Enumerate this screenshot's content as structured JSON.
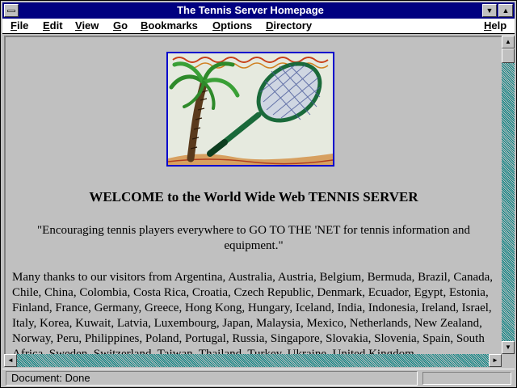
{
  "window": {
    "title": "The Tennis Server Homepage"
  },
  "menu": {
    "file": {
      "u": "F",
      "rest": "ile"
    },
    "edit": {
      "u": "E",
      "rest": "dit"
    },
    "view": {
      "u": "V",
      "rest": "iew"
    },
    "go": {
      "u": "G",
      "rest": "o"
    },
    "bookmarks": {
      "u": "B",
      "rest": "ookmarks"
    },
    "options": {
      "u": "O",
      "rest": "ptions"
    },
    "directory": {
      "u": "D",
      "rest": "irectory"
    },
    "help": {
      "u": "H",
      "rest": "elp"
    }
  },
  "page": {
    "heading": "WELCOME to the World Wide Web TENNIS SERVER",
    "quote": "\"Encouraging tennis players everywhere to GO TO THE 'NET for tennis information and equipment.\"",
    "thanks": "Many thanks to our visitors from Argentina, Australia, Austria, Belgium, Bermuda, Brazil, Canada, Chile, China, Colombia, Costa Rica, Croatia, Czech Republic, Denmark, Ecuador, Egypt, Estonia, Finland, France, Germany, Greece, Hong Kong, Hungary, Iceland, India, Indonesia, Ireland, Israel, Italy, Korea, Kuwait, Latvia, Luxembourg, Japan, Malaysia, Mexico, Netherlands, New Zealand, Norway, Peru, Philippines, Poland, Portugal, Russia, Singapore, Slovakia, Slovenia, Spain, South Africa, Sweden, Switzerland, Taiwan, Thailand, Turkey, Ukraine, United Kingdom"
  },
  "status": {
    "text": "Document: Done"
  },
  "icons": {
    "minimize": "▼",
    "maximize": "▲",
    "scroll_up": "▲",
    "scroll_down": "▼",
    "scroll_left": "◄",
    "scroll_right": "►"
  },
  "colors": {
    "titlebar": "#000080",
    "logo_border": "#0000cc",
    "scroll_track": "#008080"
  }
}
